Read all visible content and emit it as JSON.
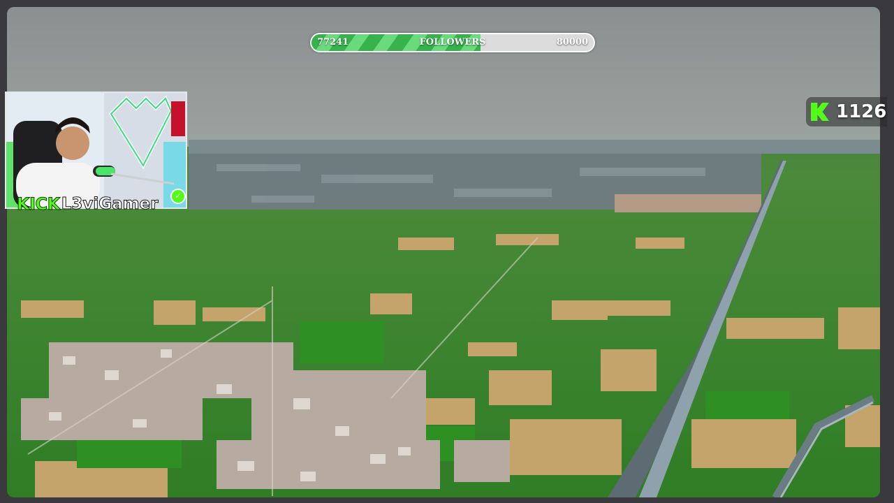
{
  "follower_goal": {
    "current": "77241",
    "label": "FOLLOWERS",
    "target": "80000",
    "progress_fraction": 0.6
  },
  "webcam": {
    "platform_label": "KICK",
    "streamer_name": "L3viGamer",
    "verified_icon": "checkmark-icon"
  },
  "viewers": {
    "icon": "kick-k-icon",
    "count": "1126"
  },
  "colors": {
    "kick_green": "#53fc18",
    "goal_green": "#37b24d"
  }
}
